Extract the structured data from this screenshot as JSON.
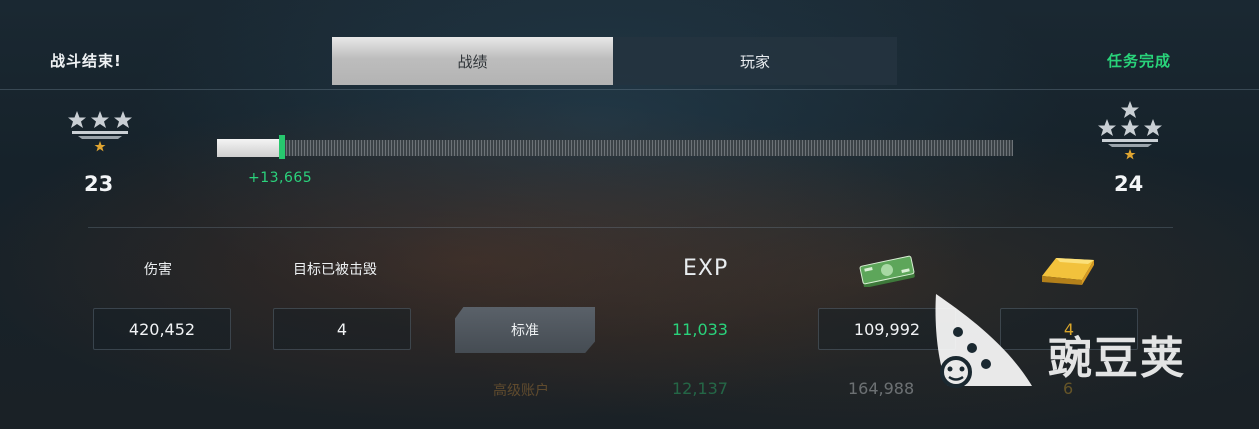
{
  "header": {
    "battle_over": "战斗结束!",
    "mission_status": "任务完成",
    "tabs": [
      {
        "label": "战绩",
        "active": true
      },
      {
        "label": "玩家",
        "active": false
      }
    ]
  },
  "rank": {
    "current_level": "23",
    "next_level": "24"
  },
  "xp_bar": {
    "gain_text": "+13,665",
    "progress_fraction": 0.08
  },
  "stats": {
    "damage_label": "伤害",
    "damage_value": "420,452",
    "destroyed_label": "目标已被击毁",
    "destroyed_value": "4",
    "exp_label": "EXP"
  },
  "rewards": {
    "standard": {
      "label": "标准",
      "exp": "11,033",
      "cash": "109,992",
      "gold": "4"
    },
    "premium": {
      "label": "高级账户",
      "exp": "12,137",
      "cash": "164,988",
      "gold": "6"
    }
  },
  "icons": {
    "cash": "cash-stack-icon",
    "gold": "gold-bar-icon",
    "rank_current": "rank-3-star-icon",
    "rank_next": "rank-4-star-icon"
  },
  "watermark": {
    "text": "豌豆荚"
  },
  "colors": {
    "accent_green": "#29d37a",
    "background": "#17232b",
    "gold": "#d9a52a",
    "premium_orange": "#c48a3a"
  }
}
